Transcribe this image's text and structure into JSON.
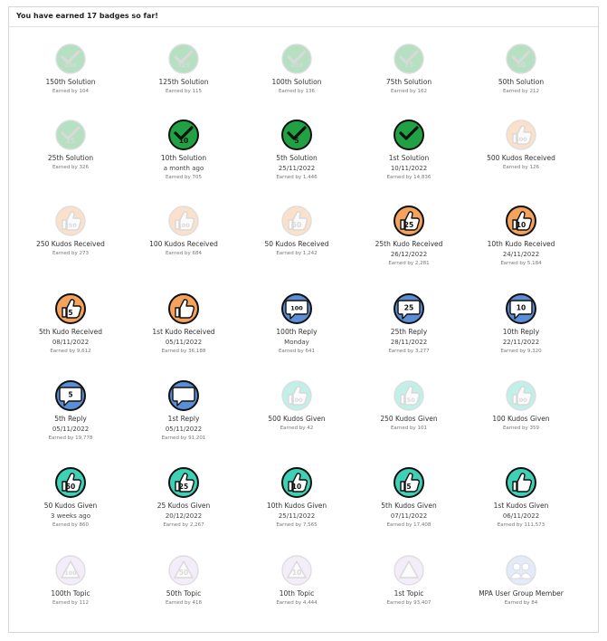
{
  "header": {
    "title": "You have earned 17 badges so far!"
  },
  "colors": {
    "solution": "#20a244",
    "kudos_received": "#f5a25d",
    "reply": "#5a8ed6",
    "kudos_given": "#3fd1b6",
    "topic": "#d9c9ee",
    "member": "#a9c2ec"
  },
  "rows": [
    [
      {
        "name": "150th Solution",
        "date": "",
        "earned": "Earned by 104",
        "type": "solution",
        "icon": "check-icon",
        "num": "150",
        "earned_flag": false
      },
      {
        "name": "125th Solution",
        "date": "",
        "earned": "Earned by 115",
        "type": "solution",
        "icon": "check-icon",
        "num": "125",
        "earned_flag": false
      },
      {
        "name": "100th Solution",
        "date": "",
        "earned": "Earned by 136",
        "type": "solution",
        "icon": "check-icon",
        "num": "100",
        "earned_flag": false
      },
      {
        "name": "75th Solution",
        "date": "",
        "earned": "Earned by 162",
        "type": "solution",
        "icon": "check-icon",
        "num": "75",
        "earned_flag": false
      },
      {
        "name": "50th Solution",
        "date": "",
        "earned": "Earned by 212",
        "type": "solution",
        "icon": "check-icon",
        "num": "50",
        "earned_flag": false
      }
    ],
    [
      {
        "name": "25th Solution",
        "date": "",
        "earned": "Earned by 326",
        "type": "solution",
        "icon": "check-icon",
        "num": "25",
        "earned_flag": false
      },
      {
        "name": "10th Solution",
        "date": "a month ago",
        "earned": "Earned by 705",
        "type": "solution",
        "icon": "check-icon",
        "num": "10",
        "earned_flag": true
      },
      {
        "name": "5th Solution",
        "date": "25/11/2022",
        "earned": "Earned by 1,446",
        "type": "solution",
        "icon": "check-icon",
        "num": "5",
        "earned_flag": true
      },
      {
        "name": "1st Solution",
        "date": "10/11/2022",
        "earned": "Earned by 14,836",
        "type": "solution",
        "icon": "check-icon",
        "num": "",
        "earned_flag": true
      },
      {
        "name": "500 Kudos Received",
        "date": "",
        "earned": "Earned by 126",
        "type": "kudos_received",
        "icon": "thumbs-up-icon",
        "num": "500",
        "earned_flag": false
      }
    ],
    [
      {
        "name": "250 Kudos Received",
        "date": "",
        "earned": "Earned by 273",
        "type": "kudos_received",
        "icon": "thumbs-up-icon",
        "num": "250",
        "earned_flag": false
      },
      {
        "name": "100 Kudos Received",
        "date": "",
        "earned": "Earned by 684",
        "type": "kudos_received",
        "icon": "thumbs-up-icon",
        "num": "100",
        "earned_flag": false
      },
      {
        "name": "50 Kudos Received",
        "date": "",
        "earned": "Earned by 1,242",
        "type": "kudos_received",
        "icon": "thumbs-up-icon",
        "num": "50",
        "earned_flag": false
      },
      {
        "name": "25th Kudo Received",
        "date": "26/12/2022",
        "earned": "Earned by 2,281",
        "type": "kudos_received",
        "icon": "thumbs-up-icon",
        "num": "25",
        "earned_flag": true
      },
      {
        "name": "10th Kudo Received",
        "date": "24/11/2022",
        "earned": "Earned by 5,184",
        "type": "kudos_received",
        "icon": "thumbs-up-icon",
        "num": "10",
        "earned_flag": true
      }
    ],
    [
      {
        "name": "5th Kudo Received",
        "date": "08/11/2022",
        "earned": "Earned by 9,612",
        "type": "kudos_received",
        "icon": "thumbs-up-icon",
        "num": "5",
        "earned_flag": true
      },
      {
        "name": "1st Kudo Received",
        "date": "05/11/2022",
        "earned": "Earned by 36,188",
        "type": "kudos_received",
        "icon": "thumbs-up-icon",
        "num": "",
        "earned_flag": true
      },
      {
        "name": "100th Reply",
        "date": "Monday",
        "earned": "Earned by 641",
        "type": "reply",
        "icon": "speech-bubble-icon",
        "num": "100",
        "earned_flag": true
      },
      {
        "name": "25th Reply",
        "date": "28/11/2022",
        "earned": "Earned by 3,277",
        "type": "reply",
        "icon": "speech-bubble-icon",
        "num": "25",
        "earned_flag": true
      },
      {
        "name": "10th Reply",
        "date": "22/11/2022",
        "earned": "Earned by 9,320",
        "type": "reply",
        "icon": "speech-bubble-icon",
        "num": "10",
        "earned_flag": true
      }
    ],
    [
      {
        "name": "5th Reply",
        "date": "05/11/2022",
        "earned": "Earned by 19,778",
        "type": "reply",
        "icon": "speech-bubble-icon",
        "num": "5",
        "earned_flag": true
      },
      {
        "name": "1st Reply",
        "date": "05/11/2022",
        "earned": "Earned by 91,201",
        "type": "reply",
        "icon": "speech-bubble-icon",
        "num": "",
        "earned_flag": true
      },
      {
        "name": "500 Kudos Given",
        "date": "",
        "earned": "Earned by 42",
        "type": "kudos_given",
        "icon": "thumbs-up-icon",
        "num": "500",
        "earned_flag": false
      },
      {
        "name": "250 Kudos Given",
        "date": "",
        "earned": "Earned by 101",
        "type": "kudos_given",
        "icon": "thumbs-up-icon",
        "num": "250",
        "earned_flag": false
      },
      {
        "name": "100 Kudos Given",
        "date": "",
        "earned": "Earned by 359",
        "type": "kudos_given",
        "icon": "thumbs-up-icon",
        "num": "100",
        "earned_flag": false
      }
    ],
    [
      {
        "name": "50 Kudos Given",
        "date": "3 weeks ago",
        "earned": "Earned by 860",
        "type": "kudos_given",
        "icon": "thumbs-up-icon",
        "num": "50",
        "earned_flag": true
      },
      {
        "name": "25 Kudos Given",
        "date": "20/12/2022",
        "earned": "Earned by 2,267",
        "type": "kudos_given",
        "icon": "thumbs-up-icon",
        "num": "25",
        "earned_flag": true
      },
      {
        "name": "10th Kudos Given",
        "date": "25/11/2022",
        "earned": "Earned by 7,565",
        "type": "kudos_given",
        "icon": "thumbs-up-icon",
        "num": "10",
        "earned_flag": true
      },
      {
        "name": "5th Kudos Given",
        "date": "07/11/2022",
        "earned": "Earned by 17,408",
        "type": "kudos_given",
        "icon": "thumbs-up-icon",
        "num": "5",
        "earned_flag": true
      },
      {
        "name": "1st Kudos Given",
        "date": "06/11/2022",
        "earned": "Earned by 111,573",
        "type": "kudos_given",
        "icon": "thumbs-up-icon",
        "num": "",
        "earned_flag": true
      }
    ],
    [
      {
        "name": "100th Topic",
        "date": "",
        "earned": "Earned by 112",
        "type": "topic",
        "icon": "triangle-icon",
        "num": "100",
        "earned_flag": false
      },
      {
        "name": "50th Topic",
        "date": "",
        "earned": "Earned by 418",
        "type": "topic",
        "icon": "triangle-icon",
        "num": "50",
        "earned_flag": false
      },
      {
        "name": "10th Topic",
        "date": "",
        "earned": "Earned by 4,444",
        "type": "topic",
        "icon": "triangle-icon",
        "num": "10",
        "earned_flag": false
      },
      {
        "name": "1st Topic",
        "date": "",
        "earned": "Earned by 93,407",
        "type": "topic",
        "icon": "triangle-icon",
        "num": "",
        "earned_flag": false
      },
      {
        "name": "MPA User Group Member",
        "date": "",
        "earned": "Earned by 84",
        "type": "member",
        "icon": "people-icon",
        "num": "",
        "earned_flag": false
      }
    ]
  ]
}
